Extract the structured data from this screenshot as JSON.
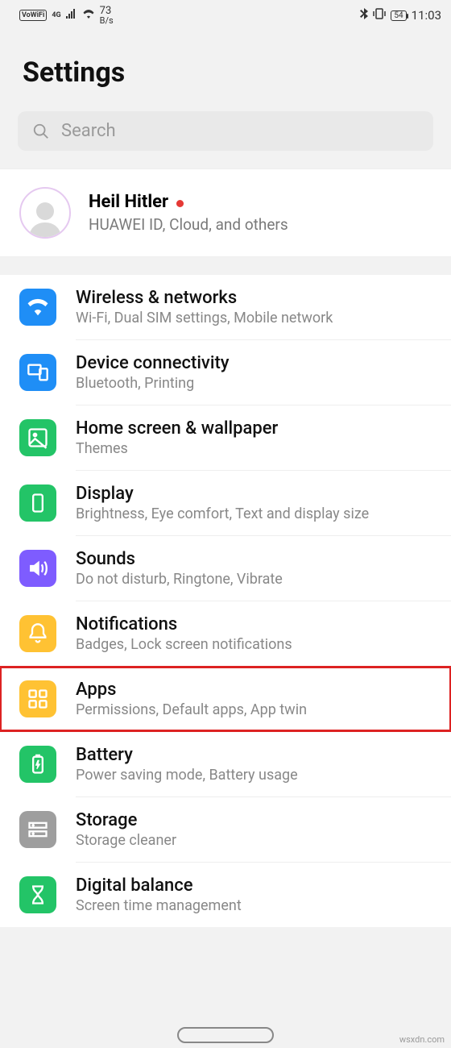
{
  "status": {
    "vowifi": "VoWiFi",
    "net": "4G",
    "bps_num": "73",
    "bps_unit": "B/s",
    "battery": "54",
    "time": "11:03"
  },
  "page_title": "Settings",
  "search": {
    "placeholder": "Search"
  },
  "account": {
    "name": "Heil Hitler",
    "sub": "HUAWEI ID, Cloud, and others"
  },
  "items": [
    {
      "label": "Wireless & networks",
      "desc": "Wi-Fi, Dual SIM settings, Mobile network",
      "color": "#1f8ef6",
      "icon": "wifi"
    },
    {
      "label": "Device connectivity",
      "desc": "Bluetooth, Printing",
      "color": "#1f8ef6",
      "icon": "devices"
    },
    {
      "label": "Home screen & wallpaper",
      "desc": "Themes",
      "color": "#23c467",
      "icon": "wallpaper"
    },
    {
      "label": "Display",
      "desc": "Brightness, Eye comfort, Text and display size",
      "color": "#23c467",
      "icon": "display"
    },
    {
      "label": "Sounds",
      "desc": "Do not disturb, Ringtone, Vibrate",
      "color": "#7e5cff",
      "icon": "sound"
    },
    {
      "label": "Notifications",
      "desc": "Badges, Lock screen notifications",
      "color": "#ffc233",
      "icon": "bell"
    },
    {
      "label": "Apps",
      "desc": "Permissions, Default apps, App twin",
      "color": "#ffc233",
      "icon": "apps",
      "highlight": true
    },
    {
      "label": "Battery",
      "desc": "Power saving mode, Battery usage",
      "color": "#23c467",
      "icon": "battery"
    },
    {
      "label": "Storage",
      "desc": "Storage cleaner",
      "color": "#9e9e9e",
      "icon": "storage"
    },
    {
      "label": "Digital balance",
      "desc": "Screen time management",
      "color": "#23c467",
      "icon": "hourglass"
    }
  ],
  "watermark": "wsxdn.com"
}
